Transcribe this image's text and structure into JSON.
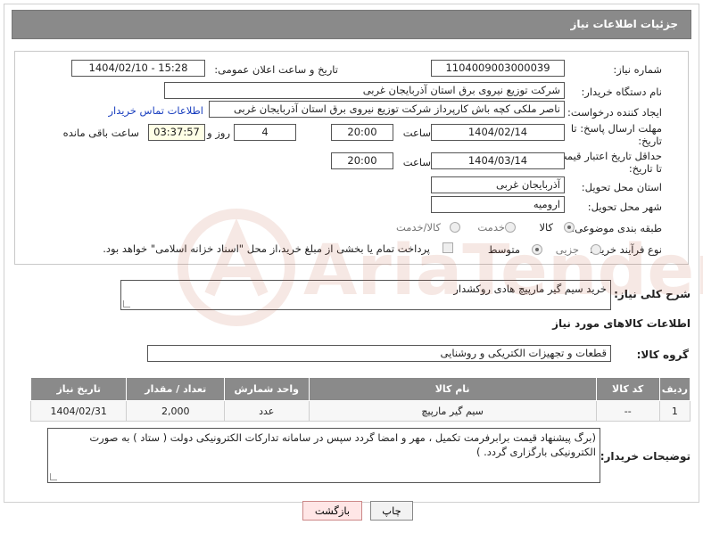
{
  "header": {
    "title": "جزئیات اطلاعات نیاز"
  },
  "fields": {
    "need_number_label": "شماره نیاز:",
    "need_number": "1104009003000039",
    "announce_label": "تاریخ و ساعت اعلان عمومی:",
    "announce_value": "1404/02/10 - 15:28",
    "buyer_org_label": "نام دستگاه خریدار:",
    "buyer_org": "شرکت توزیع نیروی برق استان آذربایجان غربی",
    "requester_label": "ایجاد کننده درخواست:",
    "requester": "ناصر ملکی کچه باش کارپرداز شرکت توزیع نیروی برق استان آذربایجان غربی",
    "contact_link": "اطلاعات تماس خریدار",
    "reply_deadline_label_1": "مهلت ارسال پاسخ: تا",
    "reply_deadline_label_2": "تاریخ:",
    "reply_date": "1404/02/14",
    "time_label": "ساعت",
    "reply_time": "20:00",
    "days_value": "4",
    "days_label": "روز و",
    "remaining_time": "03:37:57",
    "remaining_label": "ساعت باقی مانده",
    "validity_label_1": "حداقل تاریخ اعتبار قیمت:",
    "validity_label_2": "تا تاریخ:",
    "validity_date": "1404/03/14",
    "validity_time": "20:00",
    "province_label": "استان محل تحویل:",
    "province": "آذربایجان غربی",
    "city_label": "شهر محل تحویل:",
    "city": "ارومیه",
    "category_label": "طبقه بندی موضوعی:",
    "category_options": [
      "کالا",
      "خدمت",
      "کالا/خدمت"
    ],
    "category_selected": "کالا",
    "process_label": "نوع فرآیند خرید :",
    "process_options": [
      "جزیی",
      "متوسط"
    ],
    "process_selected": "متوسط",
    "payment_note": "پرداخت تمام یا بخشی از مبلغ خرید،از محل \"اسناد خزانه اسلامی\" خواهد بود."
  },
  "description": {
    "label": "شرح کلی نیاز:",
    "value": "خرید سیم گیر مارپیچ هادی روکشدار"
  },
  "goods": {
    "section_title": "اطلاعات کالاهای مورد نیاز",
    "group_label": "گروه کالا:",
    "group_value": "قطعات و تجهیزات الکتریکی و روشنایی",
    "columns": [
      "ردیف",
      "کد کالا",
      "نام کالا",
      "واحد شمارش",
      "تعداد / مقدار",
      "تاریخ نیاز"
    ],
    "rows": [
      [
        "1",
        "--",
        "سیم گیر مارپیچ",
        "عدد",
        "2,000",
        "1404/02/31"
      ]
    ]
  },
  "buyer_notes": {
    "label": "توضیحات خریدار:",
    "value": "(برگ پیشنهاد قیمت برابرفرمت تکمیل ، مهر و امضا گردد سپس در سامانه تدارکات الکترونیکی دولت ( ستاد ) به صورت الکترونیکی  بارگزاری گردد. )"
  },
  "buttons": {
    "print": "چاپ",
    "back": "بازگشت"
  },
  "watermark": {
    "text": "AriaTender.neT",
    "color": "#b84a2e"
  }
}
